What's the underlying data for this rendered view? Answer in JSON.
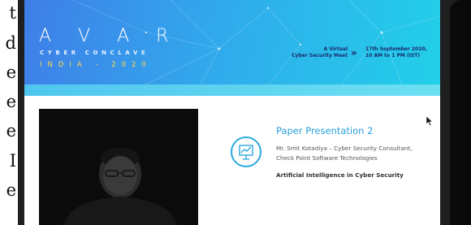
{
  "left_text": [
    "t",
    "d",
    "e",
    "e",
    "e",
    "I",
    "e"
  ],
  "banner": {
    "logo": "A V A R",
    "subtitle": "CYBER CONCLAVE",
    "edition": "INDIA - 2020",
    "meet_line1": "A Virtual",
    "meet_line2": "Cyber Security Meet",
    "arrow": "»",
    "date_line1": "17th September 2020,",
    "date_line2": "10 AM to 1 PM (IST)"
  },
  "session": {
    "title": "Paper Presentation 2",
    "speaker_line1": "Mr. Smit Kotadiya – Cyber Security Consultant,",
    "speaker_line2": "Check Point Software Technologies",
    "topic": "Artificial Intelligence in Cyber Security",
    "icon": "presentation-chart-icon"
  },
  "colors": {
    "banner_start": "#3f7ee8",
    "banner_end": "#22d0e9",
    "accent": "#2aa0dc",
    "edition": "#ffd84a",
    "frame": "#1f1f1f"
  }
}
